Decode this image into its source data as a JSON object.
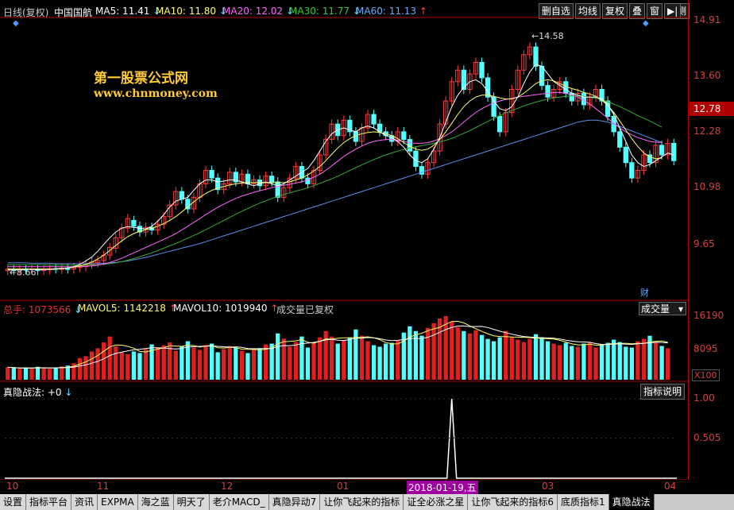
{
  "header": {
    "period": "日线(复权)",
    "stock_name": "中国国航",
    "ma": [
      {
        "label": "MA5: 11.41",
        "arrow": "↓",
        "color": "#ffffff"
      },
      {
        "label": "MA10: 11.80",
        "arrow": "↓",
        "color": "#ffff66"
      },
      {
        "label": "MA20: 12.02",
        "arrow": "↓",
        "color": "#ff66ff"
      },
      {
        "label": "MA30: 11.77",
        "arrow": "↓",
        "color": "#33cc33"
      },
      {
        "label": "MA60: 11.13",
        "arrow": "↑",
        "color": "#66aaff"
      }
    ],
    "tools": [
      "删自选",
      "均线",
      "复权",
      "叠",
      "窗",
      "预测"
    ],
    "nav_arrows": "▶|"
  },
  "watermark": {
    "title": "第一股票公式网",
    "url": "www.chnmoney.com"
  },
  "price_panel": {
    "y_ticks": [
      "14.91",
      "13.60",
      "12.28",
      "10.98",
      "9.65"
    ],
    "current_price": "12.78",
    "high_label": "14.58",
    "low_label": "8.66",
    "marker": "财"
  },
  "volume_panel": {
    "total": "总手: 1073566",
    "total_arrow": "↓",
    "mavol5": "MAVOL5: 1142218",
    "mavol5_arrow": "↑",
    "mavol10": "MAVOL10: 1019940",
    "mavol10_arrow": "↑",
    "note": "成交量已复权",
    "selector": "成交量",
    "y_ticks": [
      "16190",
      "8095"
    ],
    "unit": "X100"
  },
  "indicator_panel": {
    "label": "真隐战法: +0",
    "arrow": "↓",
    "button": "指标说明",
    "y_ticks": [
      "1.00",
      "0.505"
    ]
  },
  "x_axis": {
    "labels": [
      "10",
      "11",
      "12",
      "01",
      "03",
      "04"
    ],
    "highlight": "2018-01-19,五"
  },
  "bottom_tabs": [
    "设置",
    "指标平台",
    "资讯",
    "EXPMA",
    "海之蓝",
    "明天了",
    "老介MACD_",
    "真隐异动7",
    "让你飞起来的指标",
    "证全必涨之星",
    "让你飞起来的指标6",
    "底质指标1",
    "真隐战法"
  ],
  "active_tab": "真隐战法",
  "chart_data": {
    "type": "candlestick",
    "y_range": [
      8.3,
      15.1
    ],
    "candles": [
      [
        8.7,
        8.74
      ],
      [
        8.72,
        8.7
      ],
      [
        8.71,
        8.73
      ],
      [
        8.73,
        8.72
      ],
      [
        8.72,
        8.74
      ],
      [
        8.74,
        8.7
      ],
      [
        8.7,
        8.72
      ],
      [
        8.72,
        8.75
      ],
      [
        8.75,
        8.74
      ],
      [
        8.73,
        8.76
      ],
      [
        8.75,
        8.74
      ],
      [
        8.74,
        8.78
      ],
      [
        8.78,
        8.82
      ],
      [
        8.8,
        8.86
      ],
      [
        8.86,
        8.92
      ],
      [
        8.9,
        8.96
      ],
      [
        8.96,
        9.1
      ],
      [
        9.1,
        9.3
      ],
      [
        9.28,
        9.55
      ],
      [
        9.55,
        9.8
      ],
      [
        9.8,
        10.05
      ],
      [
        10.0,
        9.85
      ],
      [
        9.85,
        9.7
      ],
      [
        9.7,
        9.82
      ],
      [
        9.82,
        9.75
      ],
      [
        9.75,
        9.9
      ],
      [
        9.9,
        10.1
      ],
      [
        10.1,
        10.4
      ],
      [
        10.4,
        10.75
      ],
      [
        10.75,
        10.55
      ],
      [
        10.55,
        10.3
      ],
      [
        10.3,
        10.6
      ],
      [
        10.6,
        10.95
      ],
      [
        10.95,
        11.3
      ],
      [
        11.3,
        11.1
      ],
      [
        11.1,
        10.8
      ],
      [
        10.8,
        10.95
      ],
      [
        10.95,
        11.25
      ],
      [
        11.25,
        11.0
      ],
      [
        11.0,
        11.2
      ],
      [
        11.2,
        10.95
      ],
      [
        10.95,
        11.05
      ],
      [
        11.05,
        10.9
      ],
      [
        10.9,
        11.15
      ],
      [
        11.15,
        11.0
      ],
      [
        11.0,
        10.6
      ],
      [
        10.6,
        10.85
      ],
      [
        10.85,
        11.1
      ],
      [
        11.1,
        11.4
      ],
      [
        11.4,
        11.1
      ],
      [
        11.1,
        10.95
      ],
      [
        10.95,
        11.3
      ],
      [
        11.3,
        11.7
      ],
      [
        11.7,
        12.1
      ],
      [
        12.1,
        12.5
      ],
      [
        12.5,
        12.2
      ],
      [
        12.2,
        12.6
      ],
      [
        12.6,
        12.3
      ],
      [
        12.3,
        12.05
      ],
      [
        12.05,
        12.4
      ],
      [
        12.4,
        12.75
      ],
      [
        12.75,
        12.5
      ],
      [
        12.5,
        12.3
      ],
      [
        12.3,
        12.2
      ],
      [
        12.2,
        12.05
      ],
      [
        12.05,
        12.3
      ],
      [
        12.3,
        12.1
      ],
      [
        12.1,
        11.8
      ],
      [
        11.8,
        11.4
      ],
      [
        11.4,
        11.2
      ],
      [
        11.2,
        11.5
      ],
      [
        11.5,
        11.8
      ],
      [
        11.8,
        12.5
      ],
      [
        12.5,
        13.1
      ],
      [
        13.1,
        13.6
      ],
      [
        13.6,
        13.9
      ],
      [
        13.9,
        13.4
      ],
      [
        13.4,
        13.8
      ],
      [
        13.8,
        14.1
      ],
      [
        14.1,
        13.7
      ],
      [
        13.7,
        13.2
      ],
      [
        13.2,
        12.7
      ],
      [
        12.7,
        12.3
      ],
      [
        12.3,
        12.8
      ],
      [
        12.8,
        13.4
      ],
      [
        13.4,
        13.9
      ],
      [
        13.9,
        14.3
      ],
      [
        14.3,
        14.5
      ],
      [
        14.5,
        14.0
      ],
      [
        14.0,
        13.5
      ],
      [
        13.5,
        13.2
      ],
      [
        13.2,
        13.4
      ],
      [
        13.4,
        13.6
      ],
      [
        13.6,
        13.3
      ],
      [
        13.3,
        13.1
      ],
      [
        13.1,
        13.3
      ],
      [
        13.3,
        13.0
      ],
      [
        13.0,
        13.2
      ],
      [
        13.2,
        13.4
      ],
      [
        13.4,
        13.1
      ],
      [
        13.1,
        12.7
      ],
      [
        12.7,
        12.3
      ],
      [
        12.3,
        11.9
      ],
      [
        11.9,
        11.5
      ],
      [
        11.5,
        11.1
      ],
      [
        11.1,
        11.3
      ],
      [
        11.3,
        11.7
      ],
      [
        11.7,
        11.5
      ],
      [
        11.5,
        11.95
      ],
      [
        11.95,
        11.7
      ],
      [
        11.7,
        12.0
      ],
      [
        12.0,
        11.55
      ]
    ],
    "ma5": [
      8.72,
      8.72,
      8.72,
      8.73,
      8.73,
      8.72,
      8.73,
      8.73,
      8.74,
      8.75,
      8.77,
      8.8,
      8.86,
      8.95,
      9.05,
      9.2,
      9.38,
      9.55,
      9.7,
      9.8,
      9.84,
      9.82,
      9.8,
      9.78,
      9.85,
      9.98,
      10.15,
      10.35,
      10.5,
      10.55,
      10.6,
      10.78,
      10.95,
      11.05,
      11.05,
      11.0,
      11.02,
      11.05,
      11.05,
      11.0,
      10.95,
      10.9,
      10.95,
      11.0,
      10.95,
      10.9,
      10.95,
      11.05,
      11.15,
      11.25,
      11.35,
      11.55,
      11.8,
      12.05,
      12.25,
      12.35,
      12.4,
      12.35,
      12.3,
      12.4,
      12.45,
      12.4,
      12.3,
      12.2,
      12.15,
      12.05,
      11.9,
      11.7,
      11.55,
      11.5,
      11.6,
      11.85,
      12.15,
      12.55,
      12.95,
      13.25,
      13.45,
      13.6,
      13.65,
      13.55,
      13.35,
      13.1,
      12.9,
      12.85,
      12.95,
      13.2,
      13.55,
      13.85,
      14.05,
      14.0,
      13.8,
      13.6,
      13.5,
      13.4,
      13.3,
      13.25,
      13.2,
      13.2,
      13.2,
      13.15,
      13.0,
      12.75,
      12.4,
      12.05,
      11.7,
      11.5,
      11.4,
      11.45,
      11.55,
      11.65,
      11.75,
      11.7
    ],
    "ma10": [
      8.74,
      8.74,
      8.74,
      8.74,
      8.74,
      8.74,
      8.74,
      8.74,
      8.75,
      8.76,
      8.77,
      8.79,
      8.82,
      8.86,
      8.92,
      9.0,
      9.1,
      9.22,
      9.35,
      9.47,
      9.58,
      9.66,
      9.72,
      9.76,
      9.8,
      9.85,
      9.92,
      10.0,
      10.1,
      10.22,
      10.35,
      10.48,
      10.6,
      10.7,
      10.78,
      10.84,
      10.88,
      10.92,
      10.95,
      10.97,
      10.98,
      10.98,
      10.98,
      10.98,
      10.98,
      10.98,
      10.98,
      11.0,
      11.05,
      11.1,
      11.18,
      11.28,
      11.4,
      11.55,
      11.72,
      11.88,
      12.02,
      12.12,
      12.2,
      12.25,
      12.28,
      12.3,
      12.28,
      12.25,
      12.2,
      12.12,
      12.02,
      11.92,
      11.85,
      11.82,
      11.85,
      11.95,
      12.1,
      12.3,
      12.52,
      12.75,
      12.95,
      13.1,
      13.2,
      13.25,
      13.25,
      13.22,
      13.18,
      13.15,
      13.15,
      13.2,
      13.3,
      13.42,
      13.55,
      13.62,
      13.65,
      13.62,
      13.55,
      13.48,
      13.42,
      13.38,
      13.32,
      13.28,
      13.22,
      13.12,
      12.98,
      12.8,
      12.58,
      12.35,
      12.12,
      11.92,
      11.75,
      11.65,
      11.6,
      11.62
    ],
    "ma20": [
      8.8,
      8.8,
      8.8,
      8.8,
      8.8,
      8.8,
      8.8,
      8.8,
      8.8,
      8.8,
      8.8,
      8.8,
      8.8,
      8.81,
      8.82,
      8.84,
      8.87,
      8.91,
      8.96,
      9.02,
      9.09,
      9.16,
      9.23,
      9.3,
      9.37,
      9.44,
      9.51,
      9.58,
      9.66,
      9.75,
      9.85,
      9.95,
      10.05,
      10.15,
      10.25,
      10.34,
      10.42,
      10.5,
      10.57,
      10.63,
      10.68,
      10.73,
      10.77,
      10.81,
      10.85,
      10.88,
      10.91,
      10.94,
      10.97,
      11.0,
      11.05,
      11.12,
      11.2,
      11.3,
      11.42,
      11.54,
      11.66,
      11.76,
      11.85,
      11.93,
      12.0,
      12.05,
      12.08,
      12.1,
      12.1,
      12.08,
      12.05,
      12.02,
      12.0,
      12.0,
      12.02,
      12.06,
      12.12,
      12.2,
      12.3,
      12.42,
      12.55,
      12.68,
      12.8,
      12.9,
      12.98,
      13.05,
      13.1,
      13.14,
      13.17,
      13.2,
      13.22,
      13.24,
      13.26,
      13.28,
      13.3,
      13.32,
      13.32,
      13.3,
      13.26,
      13.2,
      13.12,
      13.02,
      12.9,
      12.78,
      12.65,
      12.52,
      12.4,
      12.3,
      12.22,
      12.15,
      12.1,
      12.05,
      12.03,
      12.02
    ],
    "ma30": [
      8.85,
      8.85,
      8.85,
      8.85,
      8.85,
      8.85,
      8.85,
      8.84,
      8.84,
      8.84,
      8.84,
      8.84,
      8.84,
      8.84,
      8.84,
      8.85,
      8.86,
      8.88,
      8.9,
      8.93,
      8.97,
      9.01,
      9.06,
      9.11,
      9.16,
      9.22,
      9.28,
      9.34,
      9.4,
      9.47,
      9.54,
      9.61,
      9.68,
      9.76,
      9.84,
      9.92,
      10.0,
      10.08,
      10.16,
      10.24,
      10.31,
      10.38,
      10.45,
      10.51,
      10.57,
      10.62,
      10.67,
      10.72,
      10.76,
      10.8,
      10.85,
      10.9,
      10.96,
      11.02,
      11.08,
      11.15,
      11.22,
      11.3,
      11.37,
      11.44,
      11.51,
      11.58,
      11.64,
      11.7,
      11.75,
      11.8,
      11.84,
      11.88,
      11.91,
      11.94,
      11.97,
      12.0,
      12.04,
      12.08,
      12.13,
      12.19,
      12.26,
      12.33,
      12.41,
      12.49,
      12.57,
      12.65,
      12.72,
      12.79,
      12.85,
      12.91,
      12.97,
      13.02,
      13.07,
      13.11,
      13.15,
      13.18,
      13.2,
      13.22,
      13.23,
      13.23,
      13.22,
      13.2,
      13.17,
      13.13,
      13.08,
      13.02,
      12.95,
      12.88,
      12.8,
      12.72,
      12.65,
      12.58,
      12.5,
      12.42
    ],
    "ma60": [
      8.9,
      8.9,
      8.9,
      8.9,
      8.89,
      8.89,
      8.89,
      8.89,
      8.88,
      8.88,
      8.88,
      8.88,
      8.88,
      8.88,
      8.88,
      8.88,
      8.89,
      8.9,
      8.91,
      8.93,
      8.95,
      8.98,
      9.01,
      9.04,
      9.08,
      9.12,
      9.16,
      9.2,
      9.24,
      9.28,
      9.32,
      9.36,
      9.4,
      9.45,
      9.5,
      9.55,
      9.6,
      9.65,
      9.7,
      9.75,
      9.8,
      9.85,
      9.9,
      9.95,
      10.0,
      10.05,
      10.1,
      10.15,
      10.2,
      10.25,
      10.3,
      10.35,
      10.4,
      10.45,
      10.5,
      10.55,
      10.6,
      10.65,
      10.7,
      10.75,
      10.8,
      10.85,
      10.9,
      10.95,
      11.0,
      11.05,
      11.1,
      11.15,
      11.2,
      11.25,
      11.3,
      11.35,
      11.4,
      11.45,
      11.5,
      11.55,
      11.6,
      11.65,
      11.7,
      11.75,
      11.8,
      11.85,
      11.9,
      11.95,
      12.0,
      12.05,
      12.1,
      12.15,
      12.2,
      12.25,
      12.3,
      12.35,
      12.4,
      12.45,
      12.5,
      12.55,
      12.58,
      12.6,
      12.6,
      12.58,
      12.55,
      12.5,
      12.44,
      12.38,
      12.32,
      12.26,
      12.2,
      12.14,
      12.08,
      12.02
    ],
    "volume": [
      3200,
      3000,
      2800,
      3100,
      2900,
      3300,
      3000,
      2800,
      3100,
      3400,
      3600,
      4200,
      5500,
      6000,
      7200,
      8000,
      9500,
      11000,
      8500,
      7000,
      6500,
      7200,
      6800,
      7800,
      9000,
      8200,
      8800,
      9500,
      7400,
      8600,
      9800,
      8200,
      7600,
      8800,
      9200,
      7000,
      7800,
      8600,
      8200,
      7400,
      6800,
      7600,
      8000,
      9000,
      9200,
      11800,
      10500,
      8400,
      9600,
      11000,
      8200,
      9400,
      10800,
      12400,
      11000,
      9200,
      10000,
      10800,
      12800,
      11200,
      9800,
      8800,
      8400,
      9200,
      9400,
      10000,
      12000,
      13600,
      12400,
      11200,
      13200,
      14400,
      15600,
      16200,
      14800,
      13400,
      12400,
      11800,
      12600,
      11400,
      10400,
      9800,
      10800,
      12400,
      11000,
      10200,
      9600,
      10400,
      11600,
      10800,
      9800,
      9200,
      8800,
      9400,
      8600,
      8400,
      9200,
      9600,
      8200,
      8800,
      9400,
      10200,
      9600,
      8400,
      8200,
      9800,
      10400,
      11200,
      9400,
      8600,
      8000
    ],
    "volume_max": 16190,
    "indicator_spike": {
      "index": 74,
      "value": 1.0,
      "y_range": [
        0,
        1.1
      ]
    }
  }
}
